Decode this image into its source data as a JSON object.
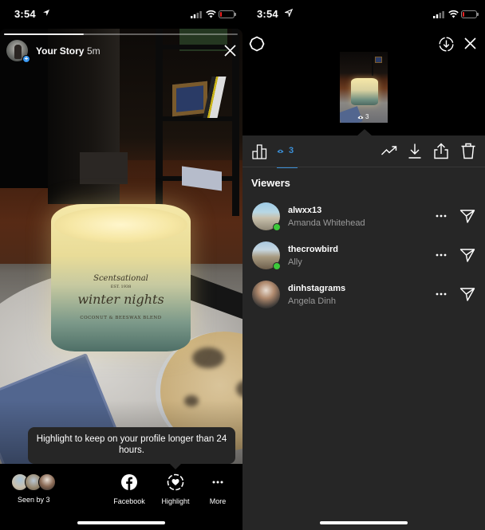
{
  "left_screen": {
    "status_bar": {
      "time": "3:54"
    },
    "story": {
      "progress_fraction": 0.34,
      "title": "Your Story",
      "time_ago": "5m",
      "photo_description": "Lit candle on marble tray",
      "candle_label": {
        "brand": "Scentsational",
        "est": "EST. 1938",
        "scent": "winter nights",
        "blend": "COCONUT & BEESWAX BLEND"
      }
    },
    "tooltip": {
      "text": "Highlight to keep on your profile longer than 24 hours."
    },
    "bottom_bar": {
      "seen_by_label": "Seen by 3",
      "actions": [
        {
          "id": "facebook",
          "label": "Facebook",
          "icon": "facebook-icon"
        },
        {
          "id": "highlight",
          "label": "Highlight",
          "icon": "highlight-heart-icon"
        },
        {
          "id": "more",
          "label": "More",
          "icon": "more-dots-icon"
        }
      ]
    }
  },
  "right_screen": {
    "status_bar": {
      "time": "3:54"
    },
    "header_icons": [
      "settings-icon",
      "save-circle-icon",
      "close-icon"
    ],
    "thumbnail": {
      "view_count": "3"
    },
    "tabs": {
      "insights_icon": "bar-chart-icon",
      "viewers_count": "3",
      "tools": [
        "promote-trend-icon",
        "download-icon",
        "share-icon",
        "delete-trash-icon"
      ]
    },
    "viewers_heading": "Viewers",
    "viewers": [
      {
        "username": "alwxx13",
        "full_name": "Amanda Whitehead",
        "online": true
      },
      {
        "username": "thecrowbird",
        "full_name": "Ally",
        "online": true
      },
      {
        "username": "dinhstagrams",
        "full_name": "Angela Dinh",
        "online": false
      }
    ]
  },
  "colors": {
    "accent_blue": "#3b8fd6",
    "online_green": "#3cc93a",
    "panel_dark": "#262626",
    "secondary_text": "#9a9a9a"
  }
}
